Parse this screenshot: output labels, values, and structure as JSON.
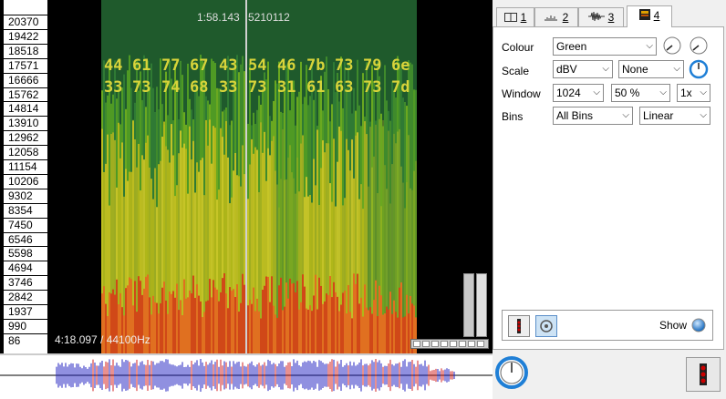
{
  "spectrogram": {
    "frequency_ticks": [
      "20370",
      "19422",
      "18518",
      "17571",
      "16666",
      "15762",
      "14814",
      "13910",
      "12962",
      "12058",
      "11154",
      "10206",
      "9302",
      "8354",
      "7450",
      "6546",
      "5598",
      "4694",
      "3746",
      "2842",
      "1937",
      "990",
      "86"
    ],
    "cursor_time": "1:58.143",
    "cursor_value": "5210112",
    "duration": "4:18.097 / 44100Hz",
    "hex_row_1": [
      "44",
      "61",
      "77",
      "67",
      "43",
      "54",
      "46",
      "7b",
      "73",
      "79",
      "6e"
    ],
    "hex_row_2": [
      "33",
      "73",
      "74",
      "68",
      "33",
      "73",
      "31",
      "61",
      "63",
      "73",
      "7d"
    ]
  },
  "tabs": [
    {
      "label": "1",
      "icon": "layers-icon"
    },
    {
      "label": "2",
      "icon": "bars-icon"
    },
    {
      "label": "3",
      "icon": "waveform-icon"
    },
    {
      "label": "4",
      "icon": "spectrogram-icon"
    }
  ],
  "settings": {
    "colour": {
      "label": "Colour",
      "value": "Green"
    },
    "scale": {
      "label": "Scale",
      "value": "dBV",
      "value2": "None"
    },
    "window": {
      "label": "Window",
      "size": "1024",
      "overlap": "50 %",
      "zoom": "1x"
    },
    "bins": {
      "label": "Bins",
      "value": "All Bins",
      "mode": "Linear"
    },
    "show_label": "Show"
  },
  "colors": {
    "accent": "#1f7fd6",
    "hex_text": "#d8d43a"
  }
}
